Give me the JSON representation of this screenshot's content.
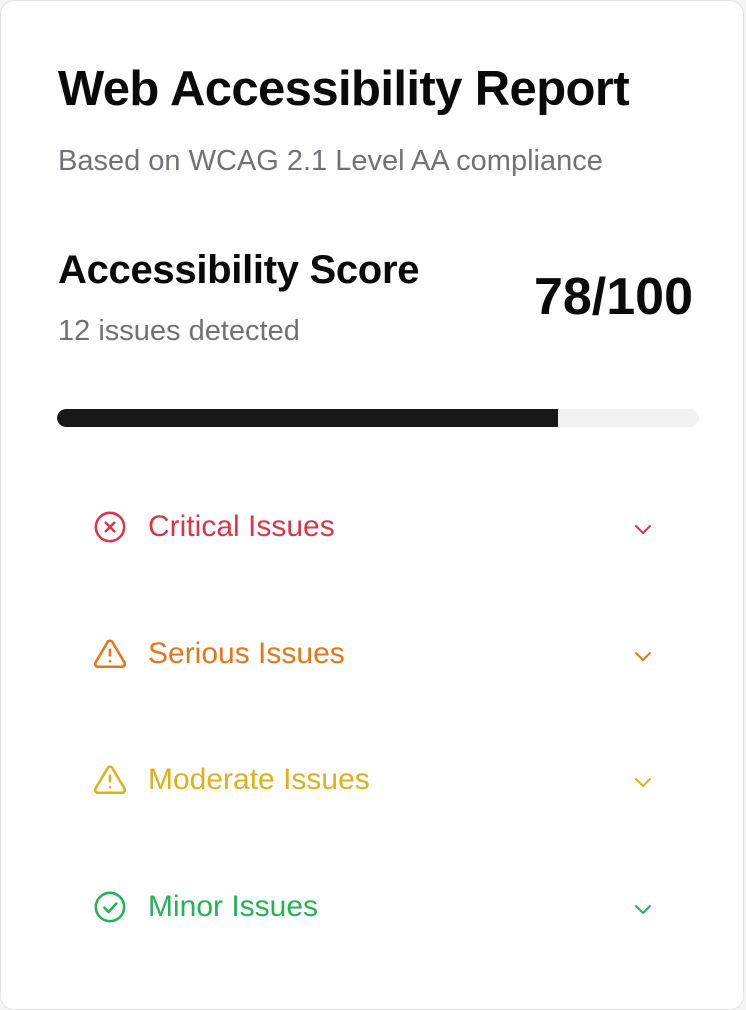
{
  "report": {
    "title": "Web Accessibility Report",
    "subtitle": "Based on WCAG 2.1 Level AA compliance"
  },
  "score": {
    "label": "Accessibility Score",
    "value_text": "78/100",
    "issues_text": "12 issues detected",
    "progress_fraction": 0.78
  },
  "sections": [
    {
      "label": "Critical Issues",
      "icon": "x-circle-icon",
      "color": "#dc3545"
    },
    {
      "label": "Serious Issues",
      "icon": "warning-triangle-icon",
      "color": "#ea7417"
    },
    {
      "label": "Moderate Issues",
      "icon": "warning-triangle-icon",
      "color": "#e0b018"
    },
    {
      "label": "Minor Issues",
      "icon": "check-circle-icon",
      "color": "#22b455"
    }
  ]
}
